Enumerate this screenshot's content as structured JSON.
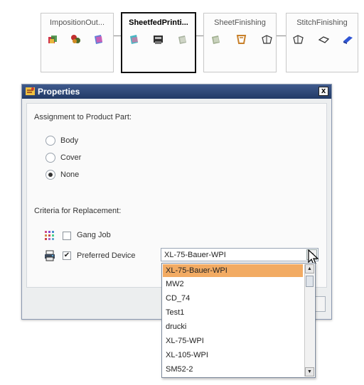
{
  "flow": {
    "nodes": [
      {
        "title": "ImpositionOut...",
        "selected": false,
        "icons": [
          "layers-icon",
          "colors-icon",
          "sheet-icon"
        ]
      },
      {
        "title": "SheetfedPrinti...",
        "selected": true,
        "icons": [
          "sheet-icon",
          "printer-icon",
          "sheet-icon"
        ]
      },
      {
        "title": "SheetFinishing",
        "selected": false,
        "icons": [
          "sheet-icon",
          "fold-icon",
          "stitch-icon"
        ]
      },
      {
        "title": "StitchFinishing",
        "selected": false,
        "icons": [
          "stitch-icon",
          "booklet-icon",
          "book-icon"
        ]
      }
    ]
  },
  "dialog": {
    "title": "Properties",
    "close_label": "x",
    "assignment_label": "Assignment to Product Part:",
    "options": [
      {
        "label": "Body",
        "checked": false
      },
      {
        "label": "Cover",
        "checked": false
      },
      {
        "label": "None",
        "checked": true
      }
    ],
    "criteria_label": "Criteria for Replacement:",
    "gang_job": {
      "label": "Gang Job",
      "checked": false
    },
    "preferred_device": {
      "label": "Preferred Device",
      "checked": true,
      "check_mark": "✔"
    },
    "device_select": {
      "value": "XL-75-Bauer-WPI",
      "arrow": "▼"
    }
  },
  "dropdown": {
    "items": [
      "XL-75-Bauer-WPI",
      "MW2",
      "CD_74",
      "Test1",
      "drucki",
      "XL-75-WPI",
      "XL-105-WPI",
      "SM52-2"
    ],
    "selected_index": 0,
    "scroll_up": "▲",
    "scroll_down": "▼"
  },
  "colors": {
    "title_bar": "#223a66",
    "selected_option": "#f2ab63"
  }
}
